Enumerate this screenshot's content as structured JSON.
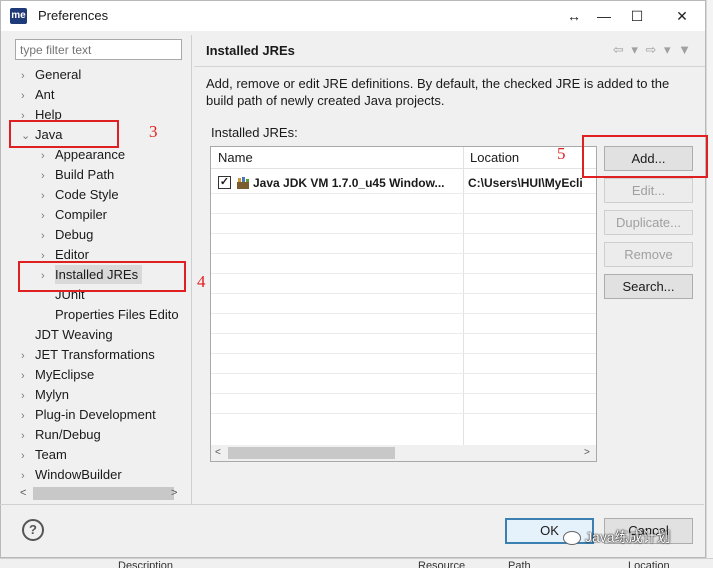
{
  "window": {
    "logo": "me",
    "title": "Preferences",
    "controls": [
      "↔",
      "—",
      "☐",
      "✕"
    ]
  },
  "left": {
    "filter_placeholder": "type filter text",
    "tree": [
      {
        "label": "General",
        "expander": "›"
      },
      {
        "label": "Ant",
        "expander": "›"
      },
      {
        "label": "Help",
        "expander": "›"
      },
      {
        "label": "Java",
        "expander": "⌄"
      },
      {
        "label": "Appearance",
        "expander": "›"
      },
      {
        "label": "Build Path",
        "expander": "›"
      },
      {
        "label": "Code Style",
        "expander": "›"
      },
      {
        "label": "Compiler",
        "expander": "›"
      },
      {
        "label": "Debug",
        "expander": "›"
      },
      {
        "label": "Editor",
        "expander": "›"
      },
      {
        "label": "Installed JREs",
        "expander": "›"
      },
      {
        "label": "JUnit",
        "expander": ""
      },
      {
        "label": "Properties Files Edito",
        "expander": ""
      },
      {
        "label": "JDT Weaving",
        "expander": ""
      },
      {
        "label": "JET Transformations",
        "expander": "›"
      },
      {
        "label": "MyEclipse",
        "expander": "›"
      },
      {
        "label": "Mylyn",
        "expander": "›"
      },
      {
        "label": "Plug-in Development",
        "expander": "›"
      },
      {
        "label": "Run/Debug",
        "expander": "›"
      },
      {
        "label": "Team",
        "expander": "›"
      },
      {
        "label": "WindowBuilder",
        "expander": "›"
      }
    ],
    "scroll_left": "<",
    "scroll_right": ">"
  },
  "panel": {
    "title": "Installed JREs",
    "nav_icons": "⇦ ▾ ⇨ ▾ ▼",
    "description": "Add, remove or edit JRE definitions. By default, the checked JRE is added to the build path of newly created Java projects.",
    "list_label": "Installed JREs:",
    "columns": {
      "name": "Name",
      "location": "Location"
    },
    "rows": [
      {
        "checked": true,
        "check_mark": "✓",
        "name": "Java JDK VM 1.7.0_u45 Window...",
        "location": "C:\\Users\\HUI\\MyEcli"
      }
    ],
    "scroll_left": "<",
    "scroll_right": ">"
  },
  "buttons": {
    "add": "Add...",
    "edit": "Edit...",
    "duplicate": "Duplicate...",
    "remove": "Remove",
    "search": "Search..."
  },
  "footer": {
    "help": "?",
    "ok": "OK",
    "cancel": "Cancel",
    "watermark": "Java练成计划"
  },
  "annotations": [
    "3",
    "4",
    "5"
  ],
  "background": {
    "bottom_columns": [
      "Description",
      "Resource",
      "Path",
      "Location"
    ]
  },
  "colors": {
    "annotation": "#e02020",
    "default_button_border": "#3c7fb1",
    "selection": "#d9d9d9"
  }
}
